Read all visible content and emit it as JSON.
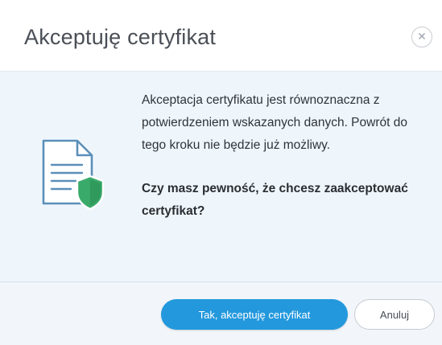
{
  "dialog": {
    "title": "Akceptuję certyfikat",
    "close_icon": "close-icon"
  },
  "content": {
    "icon": "document-shield-icon",
    "message": "Akceptacja certyfikatu jest równoznaczna z potwierdzeniem wskazanych danych. Powrót do tego kroku nie będzie już możliwy.",
    "question": "Czy masz pewność, że chcesz zaakceptować certyfikat?"
  },
  "footer": {
    "confirm_label": "Tak, akceptuję certyfikat",
    "cancel_label": "Anuluj"
  },
  "colors": {
    "primary": "#2398dd",
    "shield": "#3aaa6a",
    "content_bg": "#eef6fc",
    "icon_outline": "#5b8fb9"
  }
}
